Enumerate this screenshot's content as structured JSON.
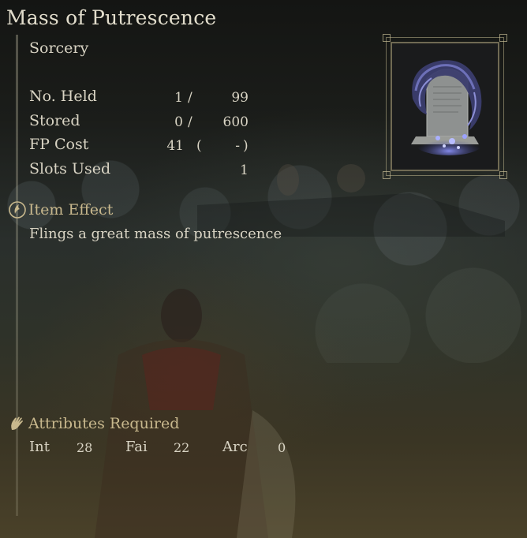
{
  "item": {
    "title": "Mass of Putrescence",
    "type": "Sorcery"
  },
  "stats": {
    "held": {
      "label": "No. Held",
      "current": "1",
      "sep": "/",
      "max": "99"
    },
    "stored": {
      "label": "Stored",
      "current": "0",
      "sep": "/",
      "max": "600"
    },
    "fp": {
      "label": "FP Cost",
      "value": "41",
      "open": "(",
      "extra": "-",
      "close": ")"
    },
    "slots": {
      "label": "Slots Used",
      "value": "1"
    }
  },
  "effect": {
    "heading": "Item Effect",
    "icon": "item-effect-icon",
    "text": "Flings a great mass of putrescence"
  },
  "attributes": {
    "heading": "Attributes Required",
    "icon": "hand-icon",
    "int_label": "Int",
    "int_value": "28",
    "fai_label": "Fai",
    "fai_value": "22",
    "arc_label": "Arc",
    "arc_value": "0"
  },
  "colors": {
    "text": "#d9d4c4",
    "heading": "#c8b88d",
    "spell_glow": "#5a5fb8"
  }
}
